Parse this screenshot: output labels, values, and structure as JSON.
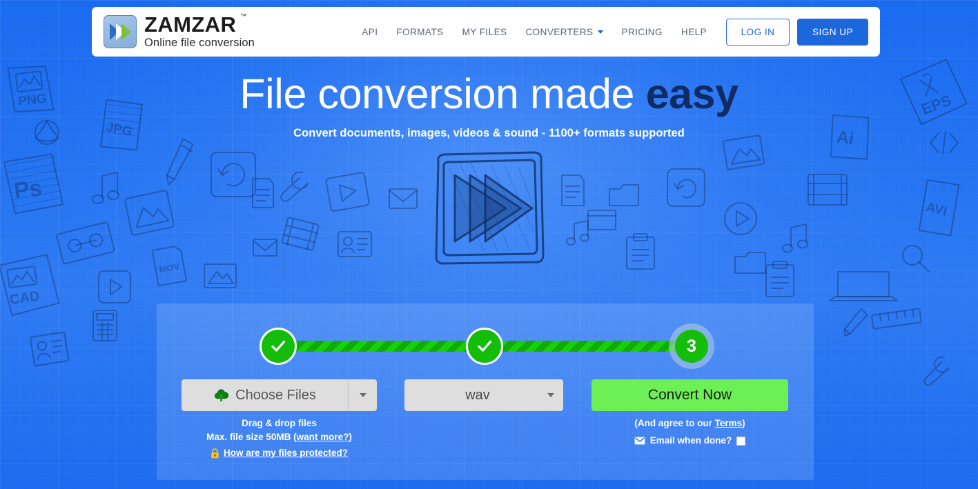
{
  "header": {
    "logo": {
      "name": "ZAMZAR",
      "tm": "™",
      "tagline": "Online file conversion",
      "icon": "zamzar-chevrons-icon"
    },
    "nav": [
      {
        "label": "API",
        "name": "nav-item-api",
        "caret": false
      },
      {
        "label": "FORMATS",
        "name": "nav-item-formats",
        "caret": false
      },
      {
        "label": "MY FILES",
        "name": "nav-item-my-files",
        "caret": false
      },
      {
        "label": "CONVERTERS",
        "name": "nav-item-converters",
        "caret": true
      },
      {
        "label": "PRICING",
        "name": "nav-item-pricing",
        "caret": false
      },
      {
        "label": "HELP",
        "name": "nav-item-help",
        "caret": false
      }
    ],
    "login_label": "LOG IN",
    "signup_label": "SIGN UP"
  },
  "hero": {
    "title_plain": "File conversion made ",
    "title_accent": "easy",
    "subtitle": "Convert documents, images, videos & sound - 1100+ formats supported",
    "illustration": "fast-forward-sketch-icon"
  },
  "panel": {
    "steps": [
      {
        "label": "✓",
        "state": "complete",
        "name": "step-1-complete"
      },
      {
        "label": "✓",
        "state": "complete",
        "name": "step-2-complete"
      },
      {
        "label": "3",
        "state": "current",
        "name": "step-3-current"
      }
    ],
    "choose_files": {
      "label": "Choose Files",
      "icon": "cloud-upload-icon",
      "dropdown_icon": "caret-down-icon"
    },
    "format": {
      "value": "wav",
      "dropdown_icon": "caret-down-icon"
    },
    "convert_label": "Convert Now",
    "help_left": {
      "line1": "Drag & drop files",
      "line2_prefix": "Max. file size 50MB (",
      "line2_link": "want more?",
      "line2_suffix": ")",
      "protected_link": "How are my files protected?",
      "lock_icon": "padlock-icon"
    },
    "help_right": {
      "terms_prefix": "(And agree to our ",
      "terms_link": "Terms",
      "terms_suffix": ")",
      "email_label": "Email when done?",
      "email_icon": "envelope-icon",
      "email_checked": false
    }
  },
  "colors": {
    "brand_blue": "#1d67dd",
    "background_blue": "#2574f2",
    "progress_green": "#16c60c",
    "convert_green": "#6df055",
    "accent_navy": "#102a63",
    "panel_overlay": "rgba(255,255,255,0.145)"
  },
  "background": {
    "doodle_labels": [
      "PNG",
      "JPG",
      "PS",
      "CAD",
      "EPS",
      "Ai",
      "AVI"
    ]
  }
}
